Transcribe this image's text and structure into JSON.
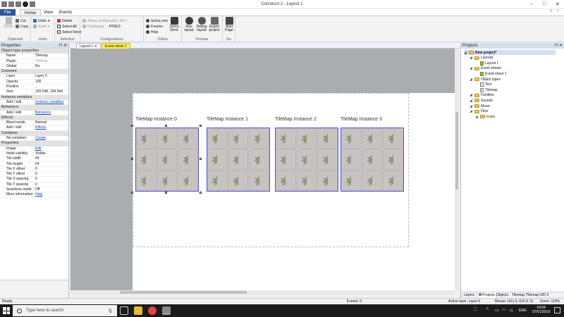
{
  "window": {
    "title": "Construct 2 - Layout 1"
  },
  "ribbon_tabs": [
    "File",
    "Home",
    "View",
    "Events"
  ],
  "ribbon": {
    "clipboard": {
      "paste": "Paste",
      "cut": "Cut",
      "copy": "Copy",
      "label": "Clipboard"
    },
    "undo": {
      "undo": "Undo",
      "redo": "Redo",
      "label": "Undo"
    },
    "selection": {
      "delete": "Delete",
      "select_all": "Select All",
      "select_none": "Select None",
      "label": "Selection"
    },
    "configurations": {
      "active": "Active configuration: All",
      "displaying_label": "Displaying:",
      "displaying_value": "HTML5",
      "label": "Configurations"
    },
    "online": {
      "scirra": "Scirra.com",
      "forums": "Forums",
      "help": "Help",
      "store": "Scirra Store",
      "label": "Online"
    },
    "preview": {
      "run": "Run layout",
      "debug": "Debug layout",
      "export": "Export project",
      "label": "Preview"
    },
    "go": {
      "start": "Start Page",
      "label": "Go"
    }
  },
  "properties": {
    "header": "Properties",
    "rows": [
      {
        "kind": "cat",
        "name": "Object type properties"
      },
      {
        "kind": "row",
        "name": "Name",
        "value": "Tilemap"
      },
      {
        "kind": "row",
        "name": "Plugin",
        "value": "Tilemap",
        "grey": true
      },
      {
        "kind": "row",
        "name": "Global",
        "value": "No"
      },
      {
        "kind": "cat",
        "name": "Common"
      },
      {
        "kind": "row",
        "name": "Layer",
        "value": "Layer 0"
      },
      {
        "kind": "row",
        "name": "Opacity",
        "value": "100"
      },
      {
        "kind": "row",
        "name": "Position",
        "value": ","
      },
      {
        "kind": "row",
        "name": "Size",
        "value": "193.548, 194.544"
      },
      {
        "kind": "cat",
        "name": "Instance variables"
      },
      {
        "kind": "row",
        "name": "Add / edit",
        "value": "Instance variables",
        "link": true
      },
      {
        "kind": "cat",
        "name": "Behaviors"
      },
      {
        "kind": "row",
        "name": "Add / edit",
        "value": "Behaviors",
        "link": true
      },
      {
        "kind": "cat",
        "name": "Effects"
      },
      {
        "kind": "row",
        "name": "Blend mode",
        "value": "Normal"
      },
      {
        "kind": "row",
        "name": "Add / edit",
        "value": "Effects",
        "link": true
      },
      {
        "kind": "cat",
        "name": "Container"
      },
      {
        "kind": "row",
        "name": "No container",
        "value": "Create",
        "link": true
      },
      {
        "kind": "cat",
        "name": "Properties"
      },
      {
        "kind": "row",
        "name": "Image",
        "value": "Edit",
        "link": true
      },
      {
        "kind": "row",
        "name": "Initial visibility",
        "value": "Visible"
      },
      {
        "kind": "row",
        "name": "Tile width",
        "value": "64"
      },
      {
        "kind": "row",
        "name": "Tile height",
        "value": "64"
      },
      {
        "kind": "row",
        "name": "Tile X offset",
        "value": "0"
      },
      {
        "kind": "row",
        "name": "Tile Y offset",
        "value": "0"
      },
      {
        "kind": "row",
        "name": "Tile X spacing",
        "value": "0"
      },
      {
        "kind": "row",
        "name": "Tile Y spacing",
        "value": "0"
      },
      {
        "kind": "row",
        "name": "Seamless mode",
        "value": "Off"
      },
      {
        "kind": "row",
        "name": "More information",
        "value": "Help",
        "link": true
      }
    ]
  },
  "doc_tabs": [
    "Layout 1",
    "Event sheet 1"
  ],
  "instances": [
    "TileMap Instance 0",
    "TileMap Instance 1",
    "TileMap Instance 2",
    "TileMap Instance 3"
  ],
  "projects": {
    "header": "Projects",
    "tree": [
      {
        "label": "New project*",
        "level": 0,
        "icon": "folder",
        "bold": true
      },
      {
        "label": "Layouts",
        "level": 1,
        "icon": "folder"
      },
      {
        "label": "Layout 1",
        "level": 2,
        "icon": "file"
      },
      {
        "label": "Event sheets",
        "level": 1,
        "icon": "folder"
      },
      {
        "label": "Event sheet 1",
        "level": 2,
        "icon": "file"
      },
      {
        "label": "Object types",
        "level": 1,
        "icon": "folder"
      },
      {
        "label": "Text",
        "level": 2,
        "icon": "text"
      },
      {
        "label": "Tilemap",
        "level": 2,
        "icon": "tilemap"
      },
      {
        "label": "Families",
        "level": 1,
        "icon": "folder"
      },
      {
        "label": "Sounds",
        "level": 1,
        "icon": "folder"
      },
      {
        "label": "Music",
        "level": 1,
        "icon": "folder"
      },
      {
        "label": "Files",
        "level": 1,
        "icon": "folder"
      },
      {
        "label": "Icons",
        "level": 2,
        "icon": "folder"
      }
    ],
    "bottom_tabs": [
      "Layers",
      "Projects",
      "Objects",
      "Tilemap: Tilemap UID 3"
    ]
  },
  "status": {
    "left": "Ready",
    "events": "Events: 0",
    "active_layer": "Active layer: Layer 0",
    "mouse": "Mouse: (611.6, 615.0, 0)",
    "zoom": "Zoom: 110%"
  },
  "taskbar": {
    "search_placeholder": "Type here to search",
    "lang": "ENG",
    "time": "18:04",
    "date": "07/01/2019"
  }
}
